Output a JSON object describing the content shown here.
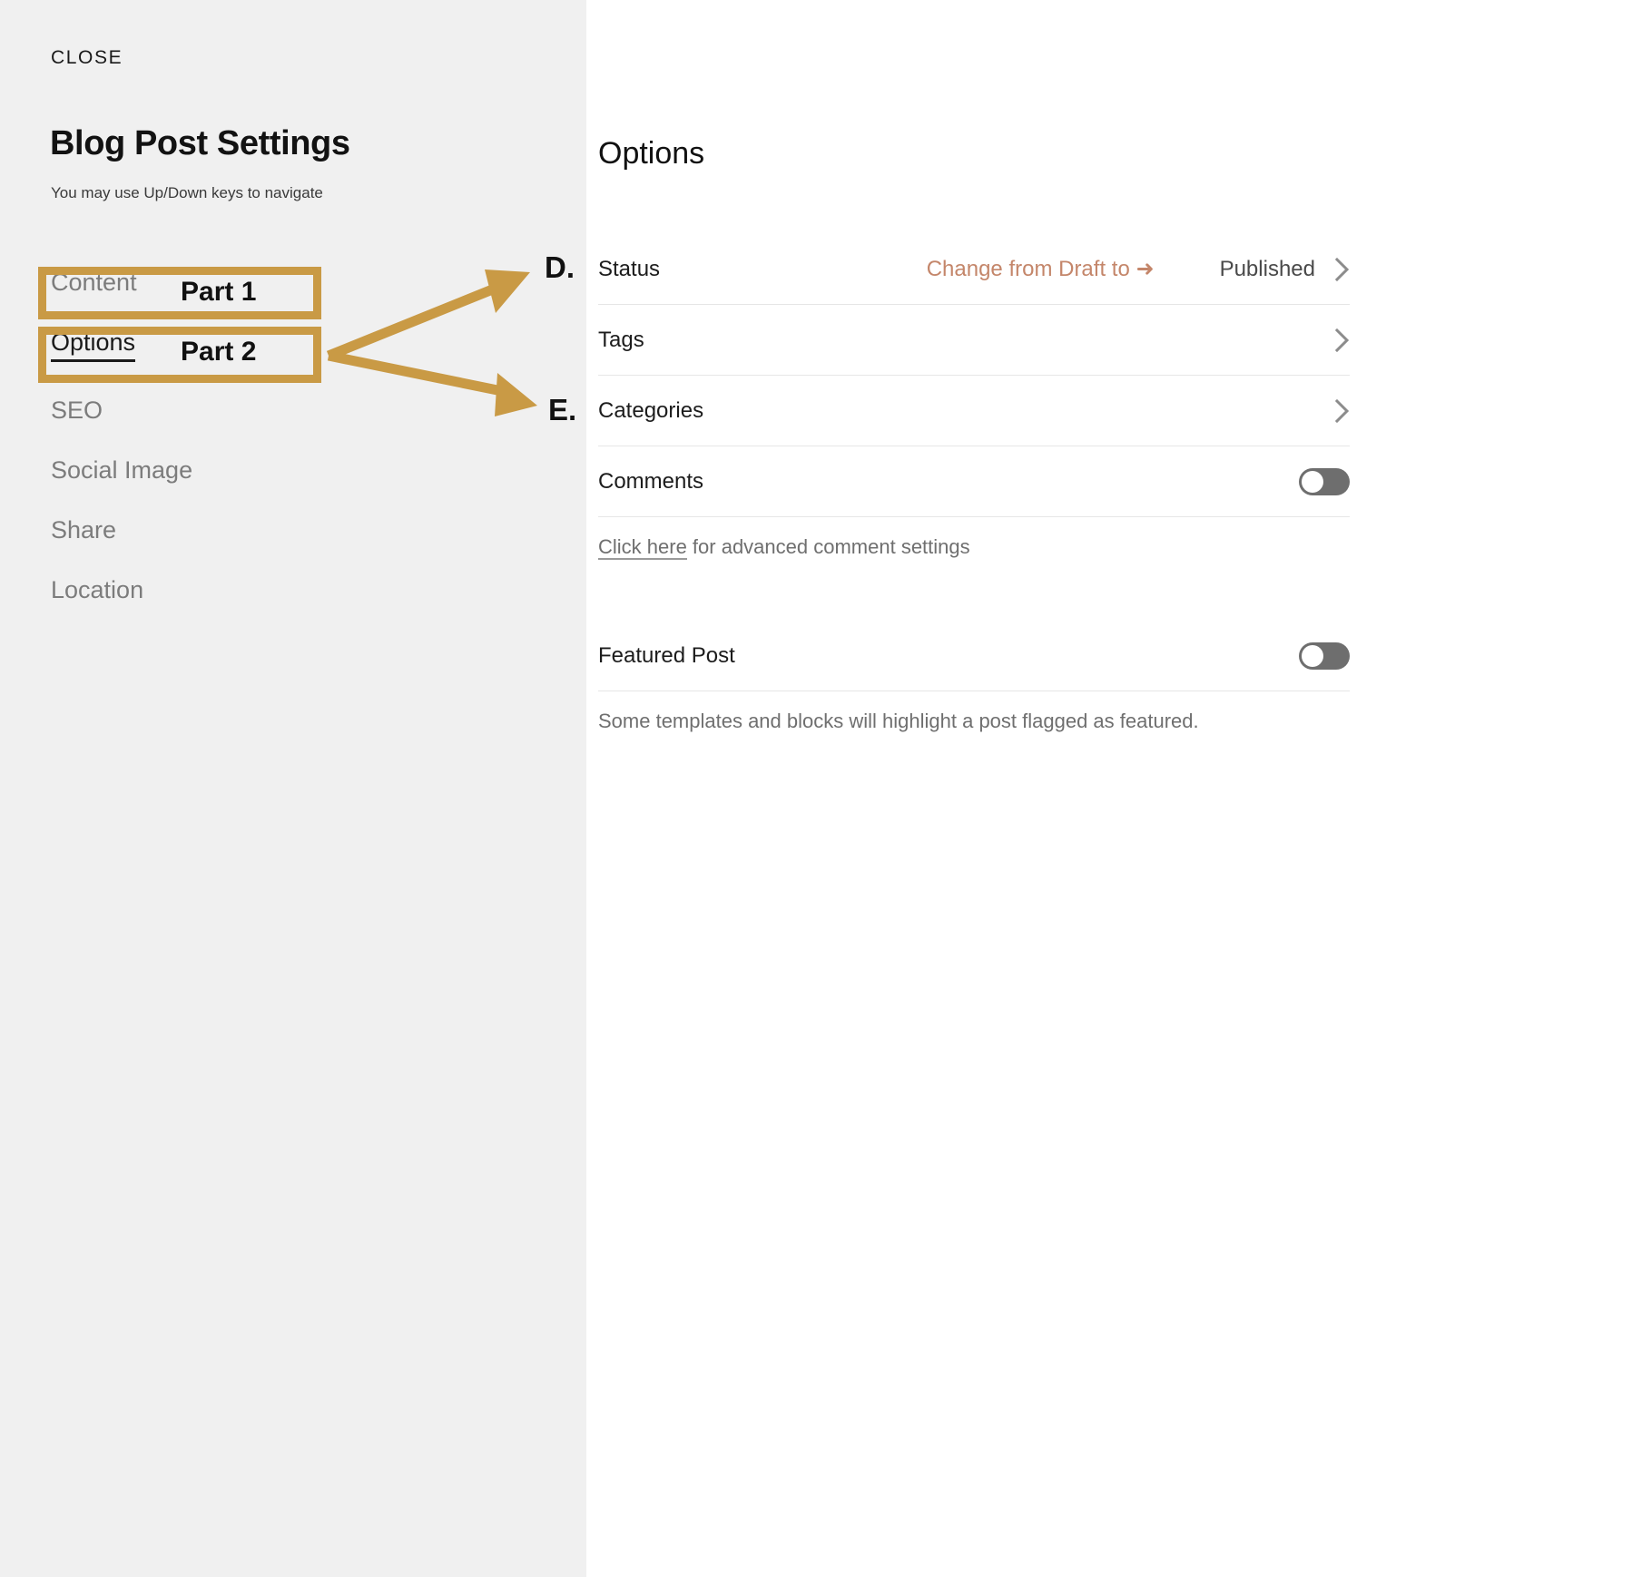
{
  "sidebar": {
    "close_label": "CLOSE",
    "title": "Blog Post Settings",
    "subtitle": "You may use Up/Down keys to navigate",
    "items": [
      {
        "label": "Content"
      },
      {
        "label": "Options"
      },
      {
        "label": "SEO"
      },
      {
        "label": "Social Image"
      },
      {
        "label": "Share"
      },
      {
        "label": "Location"
      }
    ]
  },
  "annotations": {
    "part_1": "Part 1",
    "part_2": "Part 2",
    "letter_d": "D.",
    "letter_e": "E.",
    "accent_color": "#c99a45"
  },
  "main": {
    "title": "Options",
    "rows": [
      {
        "label": "Status",
        "hint": "Change from Draft to ➜",
        "value": "Published",
        "control": "chevron"
      },
      {
        "label": "Tags",
        "hint": "",
        "value": "",
        "control": "chevron"
      },
      {
        "label": "Categories",
        "hint": "",
        "value": "",
        "control": "chevron"
      },
      {
        "label": "Comments",
        "hint": "",
        "value": "",
        "control": "toggle"
      },
      {
        "label": "Featured Post",
        "hint": "",
        "value": "",
        "control": "toggle"
      }
    ],
    "comments_note_link": "Click here",
    "comments_note_rest": " for advanced comment settings",
    "featured_note": "Some templates and blocks will highlight a post flagged as featured.",
    "status_hint_color": "#c4866a"
  }
}
